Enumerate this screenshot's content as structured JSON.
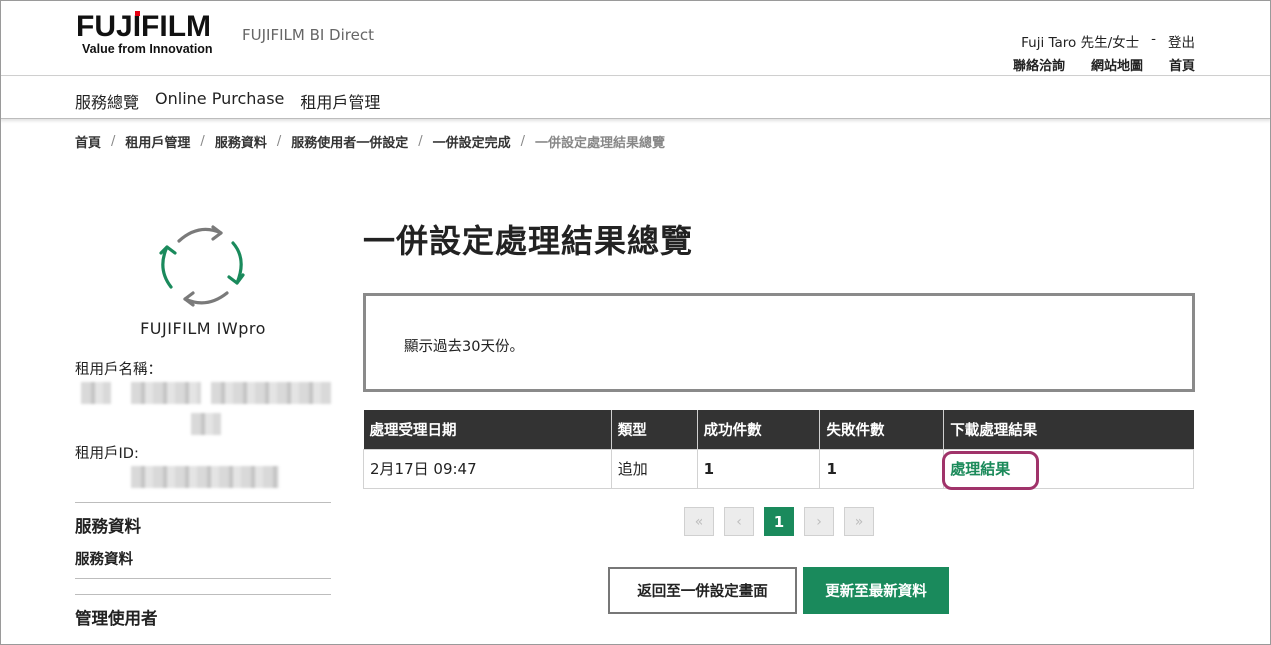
{
  "header": {
    "brand_wordmark": "FUJIFILM",
    "brand_tagline": "Value from Innovation",
    "site_name": "FUJIFILM BI Direct",
    "user_name": "Fuji Taro 先生/女士",
    "separator": "-",
    "logout_label": "登出",
    "contact_label": "聯絡洽詢",
    "sitemap_label": "網站地圖",
    "home_label": "首頁"
  },
  "nav": {
    "items": [
      {
        "label": "服務總覽"
      },
      {
        "label": "Online Purchase"
      },
      {
        "label": "租用戶管理"
      }
    ]
  },
  "breadcrumb": {
    "items": [
      {
        "label": "首頁"
      },
      {
        "label": "租用戶管理"
      },
      {
        "label": "服務資料"
      },
      {
        "label": "服務使用者一併設定"
      },
      {
        "label": "一併設定完成"
      },
      {
        "label": "一併設定處理結果總覽"
      }
    ]
  },
  "sidebar": {
    "app_icon": "recycle-arrows-icon",
    "app_name": "FUJIFILM IWpro",
    "tenant_name_label": "租用戶名稱：",
    "tenant_id_label": "租用戶ID:",
    "section1_heading": "服務資料",
    "section1_link": "服務資料",
    "section2_heading": "管理使用者"
  },
  "main": {
    "title": "一併設定處理結果總覽",
    "notice": "顯示過去30天份。",
    "table": {
      "headers": [
        "處理受理日期",
        "類型",
        "成功件數",
        "失敗件數",
        "下載處理結果"
      ],
      "rows": [
        {
          "date": "2月17日 09:47",
          "type": "追加",
          "success": "1",
          "failure": "1",
          "download": "處理結果"
        }
      ]
    },
    "pagination": {
      "first": "«",
      "prev": "‹",
      "current": "1",
      "next": "›",
      "last": "»"
    },
    "buttons": {
      "back": "返回至一併設定畫面",
      "refresh": "更新至最新資料"
    }
  },
  "colors": {
    "accent_green": "#1a8a5c",
    "table_header_bg": "#333333",
    "highlight_outline": "#a0336a",
    "logo_red": "#e60012"
  }
}
